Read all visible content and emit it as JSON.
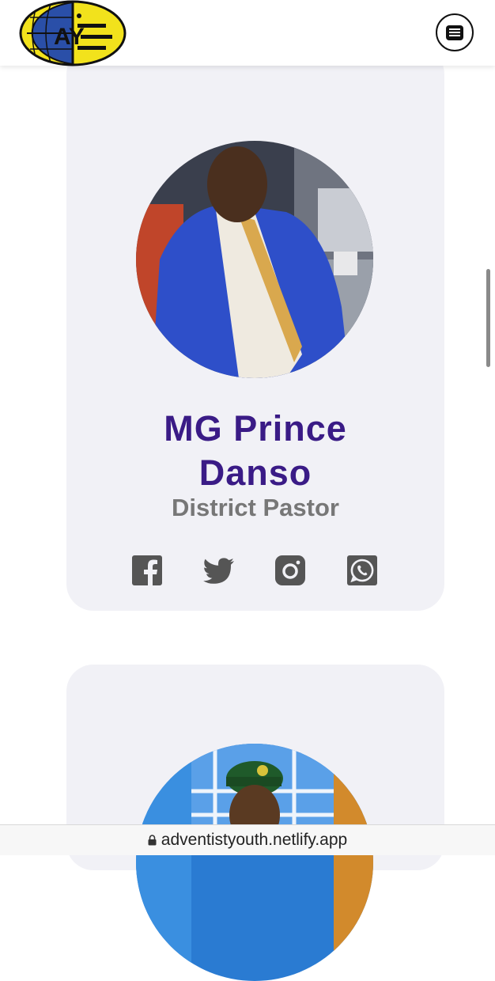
{
  "header": {
    "logo_text": "AY",
    "menu_icon": "hamburger-menu-icon"
  },
  "profiles": [
    {
      "name": "MG Prince Danso",
      "name_line1": "MG Prince",
      "name_line2": "Danso",
      "role": "District Pastor",
      "socials": [
        "facebook-icon",
        "twitter-icon",
        "instagram-icon",
        "whatsapp-icon"
      ]
    },
    {
      "name": "",
      "role": ""
    }
  ],
  "browser": {
    "url": "adventistyouth.netlify.app",
    "lock_icon": "lock-icon"
  },
  "colors": {
    "name": "#3a1b86",
    "role": "#777777",
    "card": "#f1f1f6",
    "icon": "#555555"
  }
}
